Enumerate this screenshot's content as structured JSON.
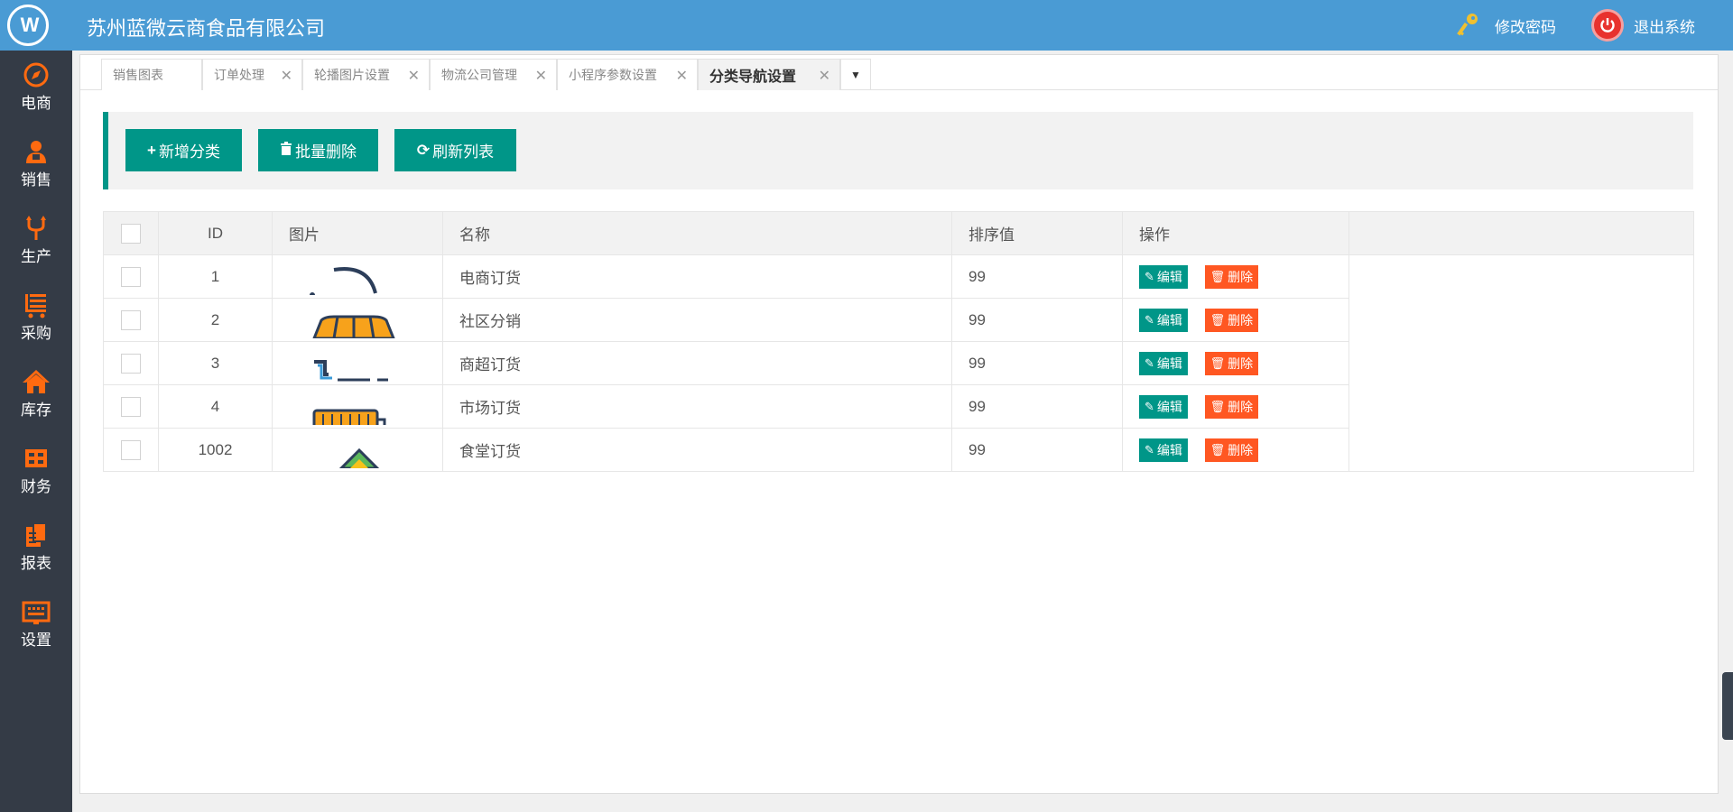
{
  "header": {
    "company": "苏州蓝微云商食品有限公司",
    "change_password": "修改密码",
    "logout": "退出系统"
  },
  "sidebar": {
    "items": [
      {
        "label": "电商",
        "icon": "compass-icon"
      },
      {
        "label": "销售",
        "icon": "user-icon"
      },
      {
        "label": "生产",
        "icon": "fork-icon"
      },
      {
        "label": "采购",
        "icon": "cart-icon"
      },
      {
        "label": "库存",
        "icon": "home-icon"
      },
      {
        "label": "财务",
        "icon": "grid-icon"
      },
      {
        "label": "报表",
        "icon": "report-icon"
      },
      {
        "label": "设置",
        "icon": "keyboard-icon"
      }
    ]
  },
  "tabs": [
    {
      "label": "销售图表"
    },
    {
      "label": "订单处理"
    },
    {
      "label": "轮播图片设置"
    },
    {
      "label": "物流公司管理"
    },
    {
      "label": "小程序参数设置"
    },
    {
      "label": "分类导航设置"
    }
  ],
  "toolbar": {
    "add": "新增分类",
    "batch_delete": "批量删除",
    "refresh": "刷新列表"
  },
  "table": {
    "headers": {
      "id": "ID",
      "image": "图片",
      "name": "名称",
      "sort": "排序值",
      "op": "操作"
    },
    "rows": [
      {
        "id": "1",
        "name": "电商订货",
        "sort": "99"
      },
      {
        "id": "2",
        "name": "社区分销",
        "sort": "99"
      },
      {
        "id": "3",
        "name": "商超订货",
        "sort": "99"
      },
      {
        "id": "4",
        "name": "市场订货",
        "sort": "99"
      },
      {
        "id": "1002",
        "name": "食堂订货",
        "sort": "99"
      }
    ],
    "edit_label": "编辑",
    "delete_label": "删除"
  },
  "colors": {
    "topbar": "#4a9bd4",
    "sidebar": "#343b46",
    "accent": "#009688",
    "danger": "#ff5722",
    "icon_orange": "#ff6a10"
  }
}
